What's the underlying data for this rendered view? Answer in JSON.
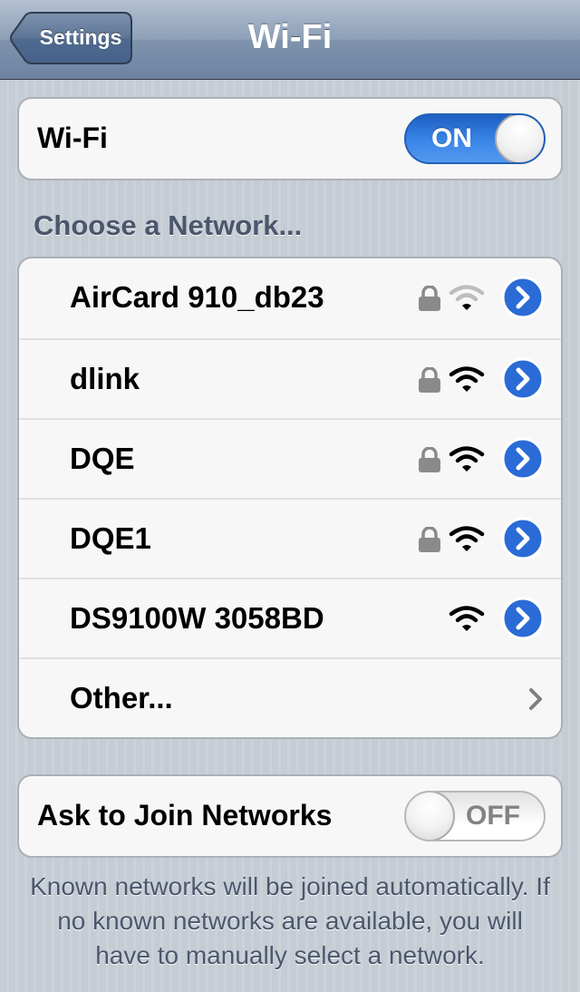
{
  "nav": {
    "back_label": "Settings",
    "title": "Wi-Fi"
  },
  "wifi_toggle": {
    "label": "Wi-Fi",
    "state": "ON"
  },
  "section_header": "Choose a Network...",
  "networks": [
    {
      "name": "AirCard 910_db23",
      "locked": true,
      "signal_bars": 1
    },
    {
      "name": "dlink",
      "locked": true,
      "signal_bars": 3
    },
    {
      "name": "DQE",
      "locked": true,
      "signal_bars": 3
    },
    {
      "name": "DQE1",
      "locked": true,
      "signal_bars": 3
    },
    {
      "name": "DS9100W 3058BD",
      "locked": false,
      "signal_bars": 3
    }
  ],
  "other": {
    "label": "Other..."
  },
  "ask_toggle": {
    "label": "Ask to Join Networks",
    "state": "OFF"
  },
  "footer": "Known networks will be joined automatically. If no known networks are available, you will have to manually select a network.",
  "icons": {
    "back": "chevron-left-button",
    "lock": "lock-icon",
    "wifi": "wifi-signal-icon",
    "detail": "detail-disclosure-icon",
    "other": "chevron-right-icon"
  },
  "colors": {
    "nav_bar": "#8d9fb7",
    "toggle_on": "#3a86e8",
    "detail_button": "#2a6bd6",
    "section_text": "#4c566c",
    "wifi_strong": "#000000",
    "wifi_weak": "#bdbdbd",
    "lock": "#8a8a8a"
  }
}
